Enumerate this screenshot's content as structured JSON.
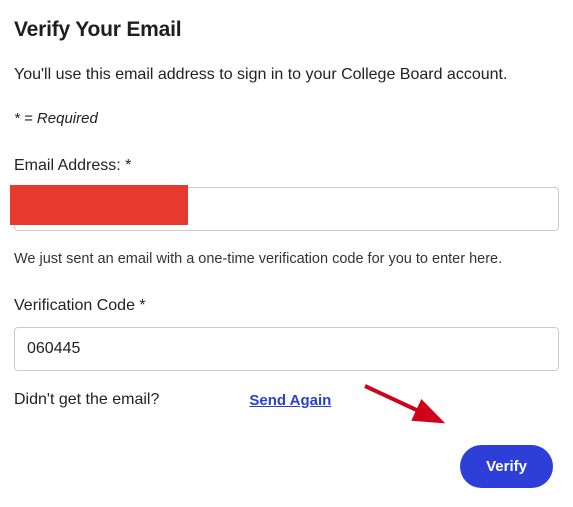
{
  "title": "Verify Your Email",
  "subtitle": "You'll use this email address to sign in to your College Board account.",
  "required_note": "* = Required",
  "email": {
    "label": "Email Address: *",
    "value": "",
    "helper": "We just sent an email with a one-time verification code for you to enter here."
  },
  "code": {
    "label": "Verification Code *",
    "value": "060445"
  },
  "resend": {
    "question": "Didn't get the email?",
    "link_label": "Send Again"
  },
  "verify_label": "Verify"
}
